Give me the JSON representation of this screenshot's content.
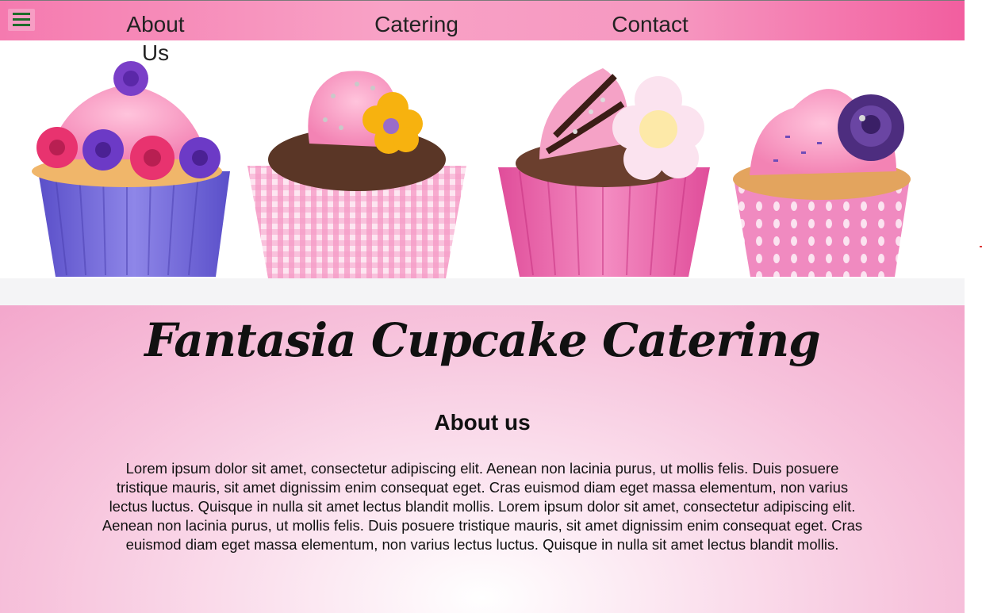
{
  "nav": {
    "menu_icon": "hamburger-menu-icon",
    "links": [
      {
        "label": "About Us"
      },
      {
        "label": "Catering"
      },
      {
        "label": "Contact"
      }
    ],
    "colors": {
      "start": "#f57aaf",
      "end": "#f25e9f"
    }
  },
  "hero": {
    "image": "four-decorated-cupcakes-photo"
  },
  "main": {
    "title": "Fantasia Cupcake Catering",
    "heading": "About us",
    "paragraph": "Lorem ipsum dolor sit amet, consectetur adipiscing elit. Aenean non lacinia purus, ut mollis felis. Duis posuere tristique mauris, sit amet dignissim enim consequat eget. Cras euismod diam eget massa elementum, non varius lectus luctus. Quisque in nulla sit amet lectus blandit mollis. Lorem ipsum dolor sit amet, consectetur adipiscing elit. Aenean non lacinia purus, ut mollis felis. Duis posuere tristique mauris, sit amet dignissim enim consequat eget. Cras euismod diam eget massa elementum, non varius lectus luctus. Quisque in nulla sit amet lectus blandit mollis.",
    "background_color": "#f3a7cc"
  }
}
